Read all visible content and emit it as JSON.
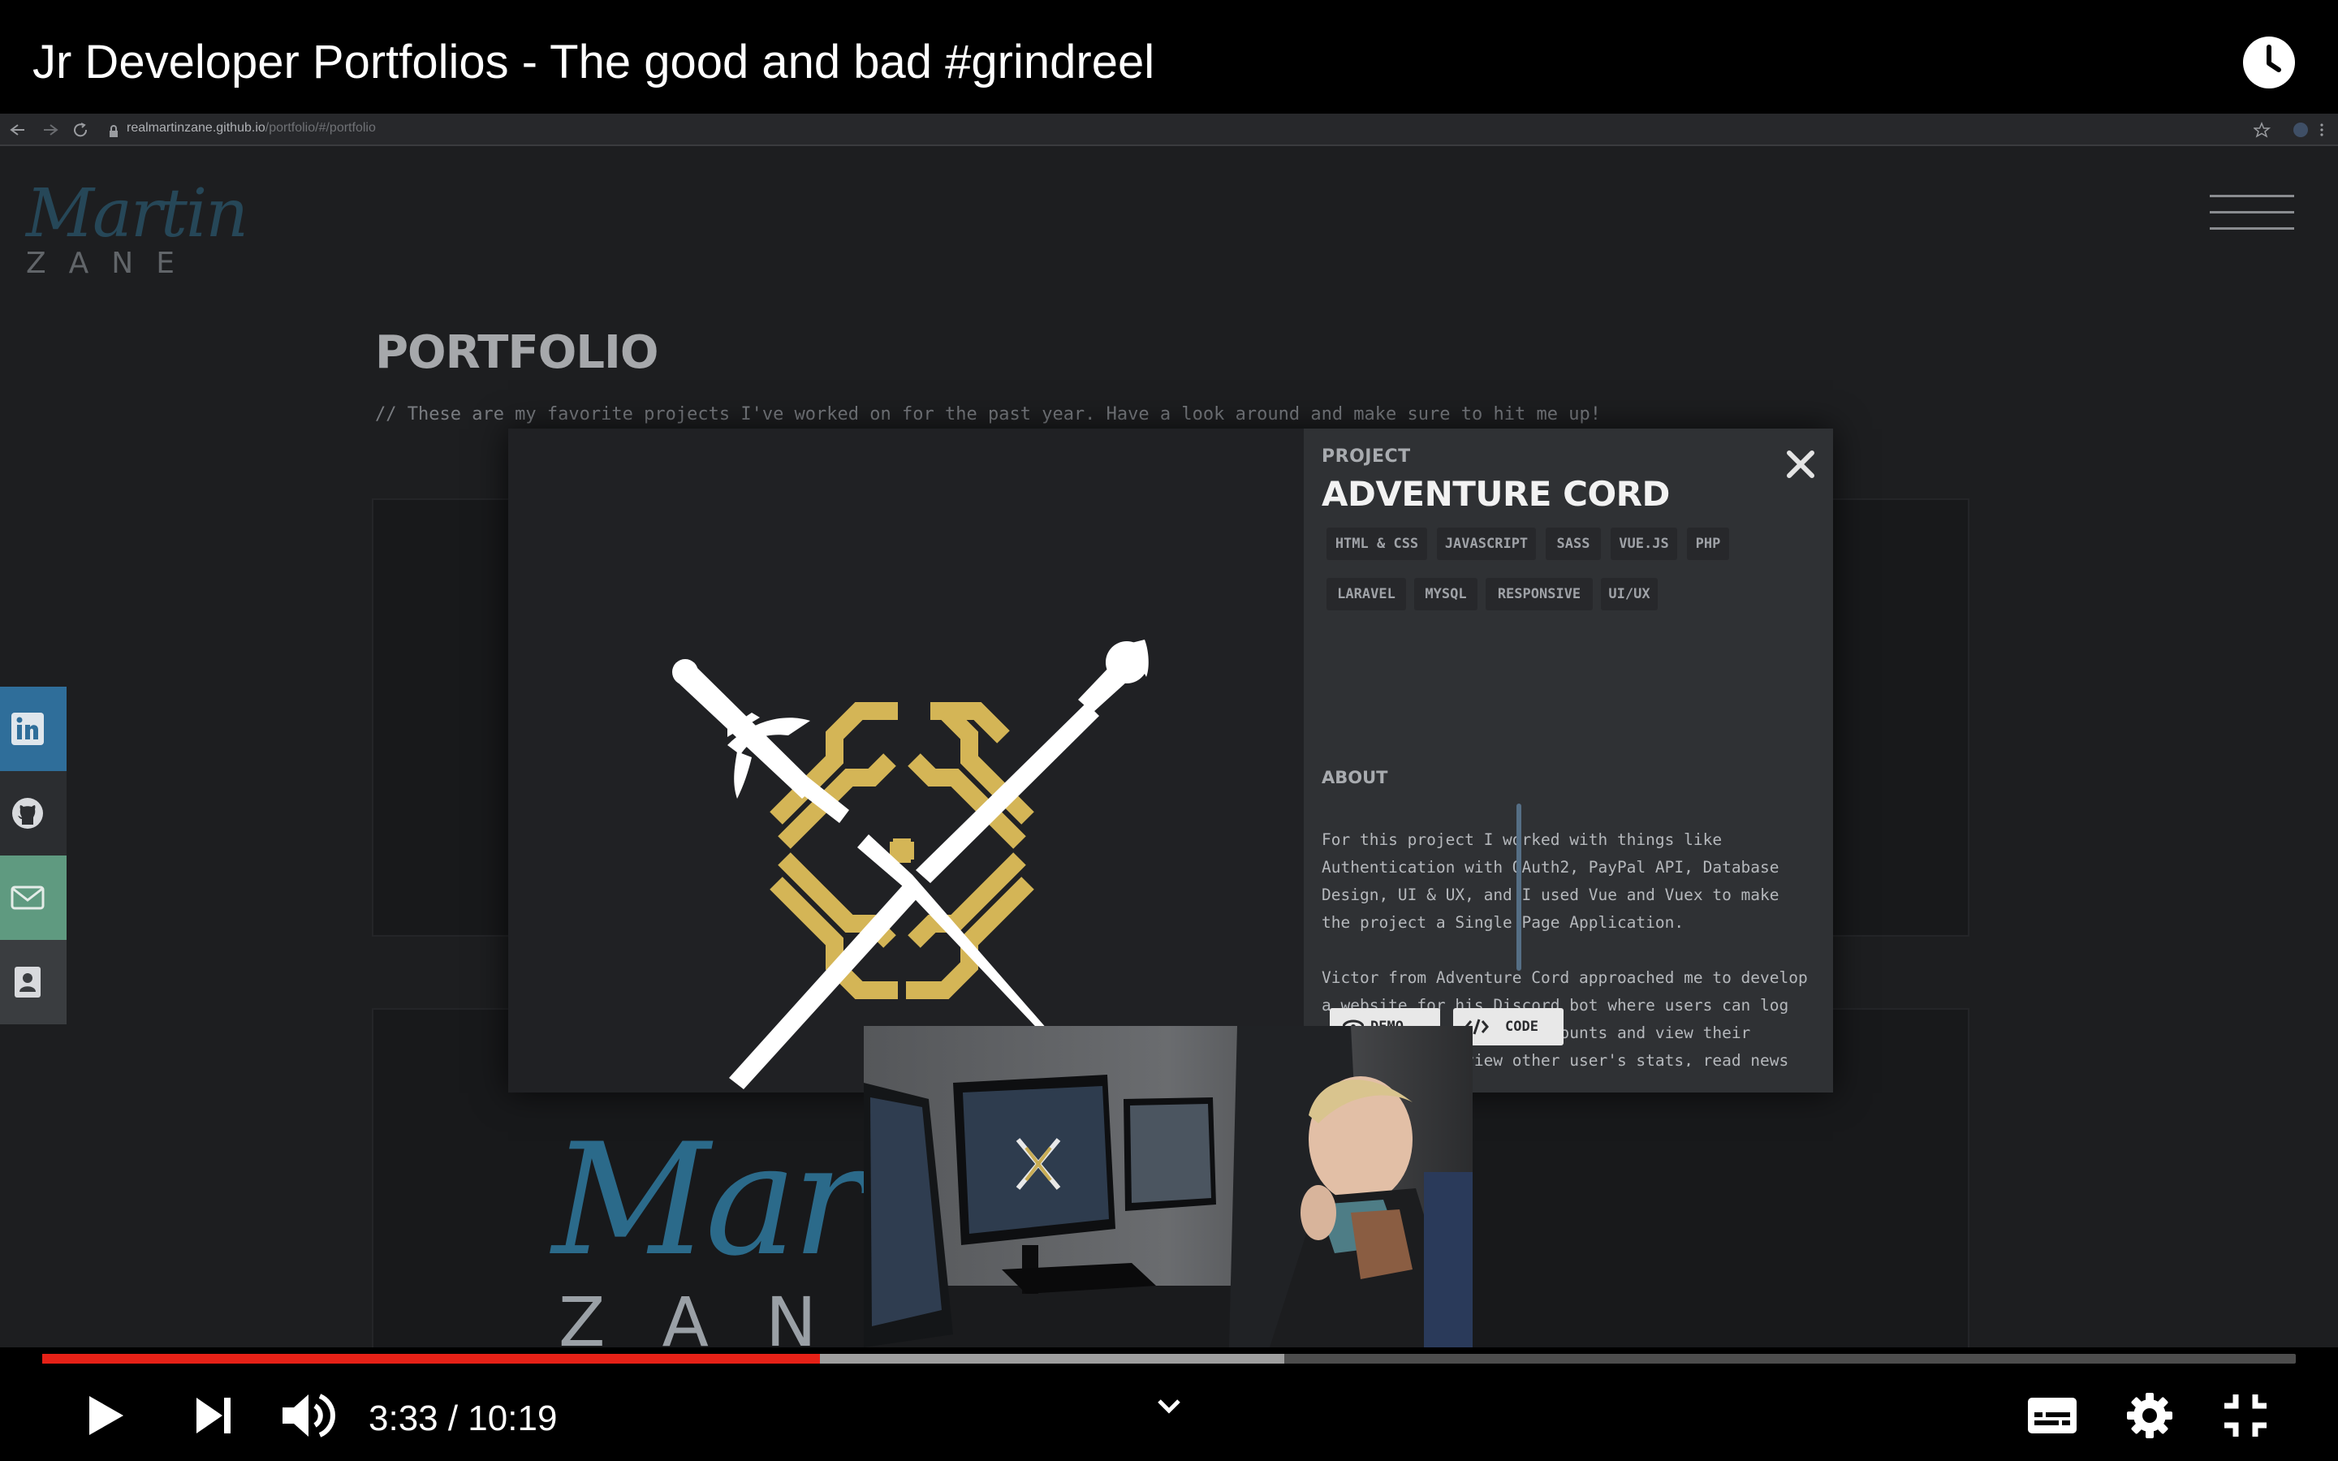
{
  "video": {
    "title": "Jr Developer Portfolios - The good and bad #grindreel",
    "current_time": "3:33",
    "duration": "10:19",
    "time_display": "3:33 / 10:19",
    "played_fraction": 0.345,
    "buffered_fraction": 0.551
  },
  "browser": {
    "url_host": "realmartinzane.github.io",
    "url_path": "/portfolio/#/portfolio"
  },
  "site": {
    "logo_script": "Martin",
    "logo_block": "ZANE",
    "heading": "PORTFOLIO",
    "subheading": "// These are my favorite projects I've worked on for the past year. Have a look around and make sure to hit me up!",
    "social": [
      "linkedin-icon",
      "github-icon",
      "mail-icon",
      "contact-card-icon"
    ]
  },
  "modal": {
    "label": "PROJECT",
    "title": "ADVENTURE CORD",
    "tags": [
      "HTML & CSS",
      "JAVASCRIPT",
      "SASS",
      "VUE.JS",
      "PHP",
      "LARAVEL",
      "MYSQL",
      "RESPONSIVE",
      "UI/UX"
    ],
    "about_label": "ABOUT",
    "paragraphs": [
      "For this project I worked with things like\nAuthentication with OAuth2, PayPal API, Database\nDesign, UI & UX, and I used Vue and Vuex to make\nthe project a Single Page Application.",
      "Victor from Adventure Cord approached me to develop\na website for his Discord bot where users can log\nin with their Discord accounts and view their\nprofile stats, view other user's stats, read news\nand updates for the bot directly from the team and"
    ],
    "demo_label": "DEMO",
    "code_label": "CODE"
  },
  "colors": {
    "progress_played": "#e62117",
    "progress_buffered": "#9e9e9e",
    "logo_gold": "#d4b556",
    "linkedin": "#2f6e9a",
    "mail": "#5f9a80"
  }
}
